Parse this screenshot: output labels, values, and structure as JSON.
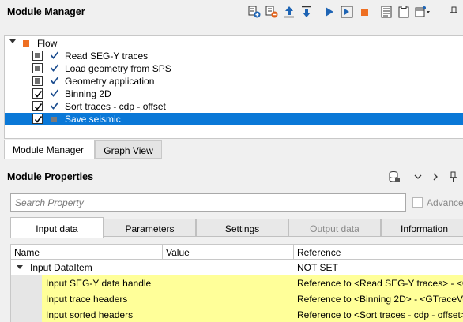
{
  "module_manager": {
    "title": "Module Manager",
    "toolbar": [
      {
        "name": "add-module-icon"
      },
      {
        "name": "remove-module-icon"
      },
      {
        "name": "move-up-icon"
      },
      {
        "name": "move-down-icon"
      },
      {
        "name": "run-icon"
      },
      {
        "name": "run-step-icon"
      },
      {
        "name": "stop-icon"
      },
      {
        "name": "log-icon"
      },
      {
        "name": "clipboard-icon"
      },
      {
        "name": "window-options-icon"
      },
      {
        "name": "pin-icon"
      }
    ],
    "flow": {
      "label": "Flow",
      "items": [
        {
          "label": "Read SEG-Y traces",
          "enabled": "partial",
          "status": "done"
        },
        {
          "label": "Load geometry from SPS",
          "enabled": "partial",
          "status": "done"
        },
        {
          "label": "Geometry application",
          "enabled": "partial",
          "status": "done"
        },
        {
          "label": "Binning 2D",
          "enabled": "checked",
          "status": "done"
        },
        {
          "label": "Sort traces - cdp - offset",
          "enabled": "checked",
          "status": "done"
        },
        {
          "label": "Save seismic",
          "enabled": "checked",
          "status": "pending",
          "selected": true
        }
      ]
    },
    "tabs": [
      {
        "label": "Module Manager",
        "active": true
      },
      {
        "label": "Graph View",
        "active": false
      }
    ]
  },
  "module_properties": {
    "title": "Module Properties",
    "header_icons": [
      "database-icon",
      "chevron-down-icon",
      "chevron-right-icon",
      "pin-icon"
    ],
    "search": {
      "placeholder": "Search Property",
      "value": ""
    },
    "advanced": {
      "label": "Advance",
      "checked": false
    },
    "tabs": [
      {
        "label": "Input data",
        "active": true,
        "enabled": true
      },
      {
        "label": "Parameters",
        "active": false,
        "enabled": true
      },
      {
        "label": "Settings",
        "active": false,
        "enabled": true
      },
      {
        "label": "Output data",
        "active": false,
        "enabled": false
      },
      {
        "label": "Information",
        "active": false,
        "enabled": true
      }
    ],
    "grid": {
      "columns": [
        "Name",
        "Value",
        "Reference"
      ],
      "group": {
        "name": "Input DataItem",
        "value": "",
        "reference": "NOT SET"
      },
      "rows": [
        {
          "name": "Input SEG-Y data handle",
          "value": "",
          "reference": "Reference to <Read SEG-Y traces> - <GR"
        },
        {
          "name": "Input trace headers",
          "value": "",
          "reference": "Reference to <Binning 2D> - <GTraceVe"
        },
        {
          "name": "Input sorted headers",
          "value": "",
          "reference": "Reference to <Sort traces - cdp - offset>"
        }
      ]
    }
  },
  "colors": {
    "selection": "#0a78d7",
    "flow_marker": "#ee6f22",
    "row_highlight": "#ffff99",
    "check": "#1c4d8f"
  }
}
